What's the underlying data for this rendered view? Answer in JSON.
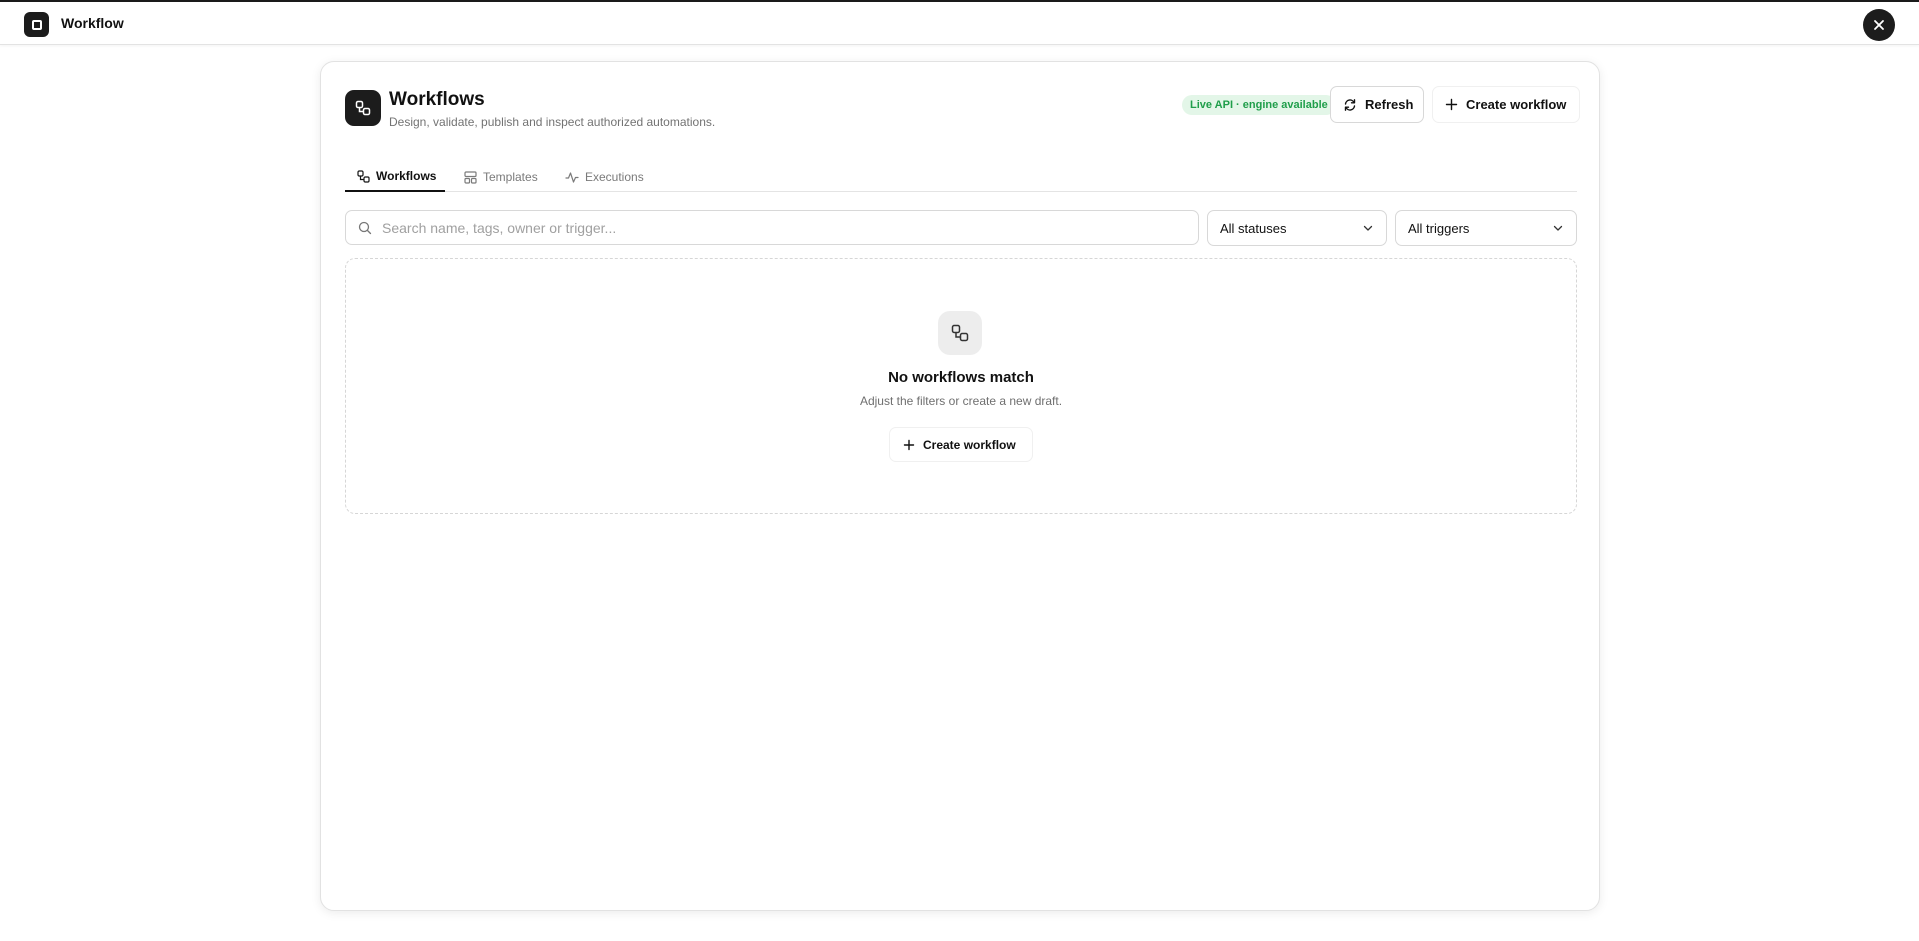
{
  "app": {
    "title": "Workflow",
    "close_icon": "close-icon",
    "logo_icon": "app-logo-icon"
  },
  "header": {
    "title": "Workflows",
    "subtitle": "Design, validate, publish and inspect authorized automations.",
    "icon": "workflow-icon",
    "status_badge": "Live API · engine available",
    "refresh_label": "Refresh",
    "create_label": "Create workflow"
  },
  "tabs": [
    {
      "label": "Workflows",
      "icon": "workflow-icon",
      "active": true
    },
    {
      "label": "Templates",
      "icon": "template-icon",
      "active": false
    },
    {
      "label": "Executions",
      "icon": "activity-icon",
      "active": false
    }
  ],
  "filters": {
    "search_placeholder": "Search name, tags, owner or trigger...",
    "search_value": "",
    "status_selected": "All statuses",
    "trigger_selected": "All triggers"
  },
  "empty_state": {
    "title": "No workflows match",
    "subtitle": "Adjust the filters or create a new draft.",
    "create_label": "Create workflow",
    "icon": "workflow-icon"
  },
  "colors": {
    "accent": "#1c1c1c",
    "badge_bg": "#e3f6e8",
    "badge_text": "#1f9e4a",
    "border": "#d8d8d8"
  }
}
